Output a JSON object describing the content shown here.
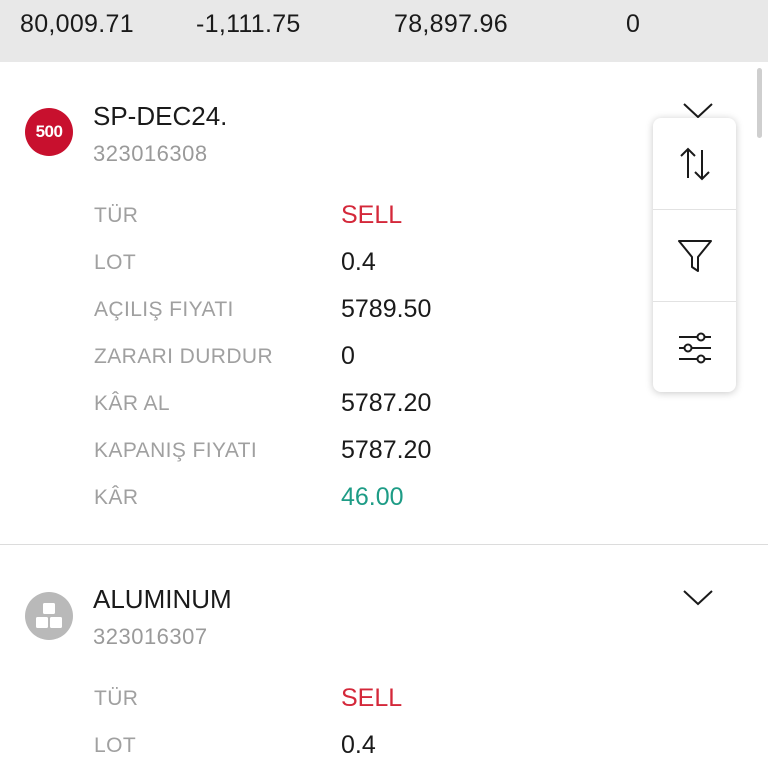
{
  "summary": {
    "values": [
      "80,009.71",
      "-1,111.75",
      "78,897.96",
      "0"
    ]
  },
  "positions": [
    {
      "symbol": "SP-DEC24.",
      "ticket": "323016308",
      "icon_text": "500",
      "icon": "sp500-badge-icon",
      "rows": [
        {
          "label": "TÜR",
          "value": "SELL"
        },
        {
          "label": "LOT",
          "value": "0.4"
        },
        {
          "label": "AÇILIŞ FIYATI",
          "value": "5789.50"
        },
        {
          "label": "ZARARI DURDUR",
          "value": "0"
        },
        {
          "label": "KÂR AL",
          "value": "5787.20"
        },
        {
          "label": "KAPANIŞ FIYATI",
          "value": "5787.20"
        },
        {
          "label": "KÂR",
          "value": "46.00"
        }
      ]
    },
    {
      "symbol": "ALUMINUM",
      "ticket": "323016307",
      "icon": "aluminum-cubes-icon",
      "rows": [
        {
          "label": "TÜR",
          "value": "SELL"
        },
        {
          "label": "LOT",
          "value": "0.4"
        }
      ]
    }
  ],
  "fab_menu": {
    "items": [
      "sort-arrows-icon",
      "filter-funnel-icon",
      "sliders-settings-icon"
    ]
  },
  "colors": {
    "sell": "#d4283a",
    "profit": "#1e9c86",
    "brand_red": "#c8102e",
    "summary_bg": "#e8e8e8"
  }
}
